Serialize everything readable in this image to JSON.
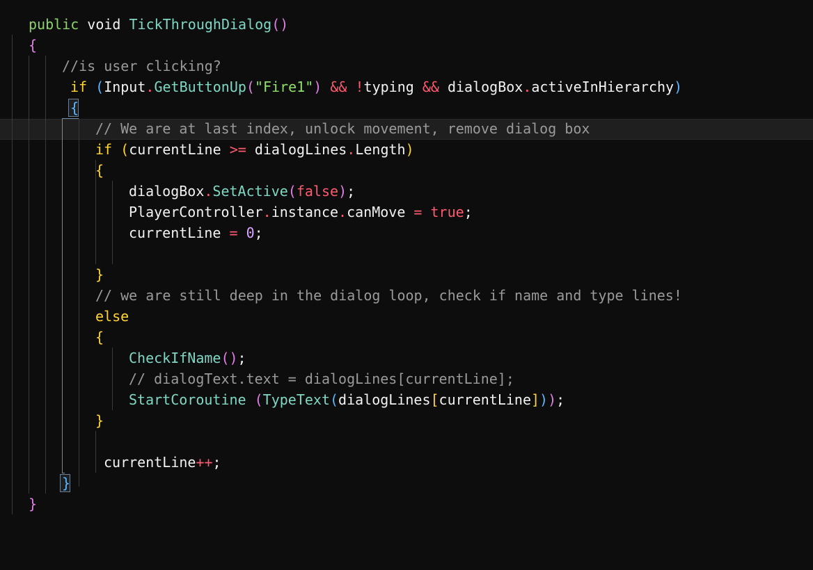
{
  "editor": {
    "lines": [
      [
        [
          "kw2",
          "public"
        ],
        [
          "txt",
          " "
        ],
        [
          "txt",
          "void"
        ],
        [
          "txt",
          " "
        ],
        [
          "fn",
          "TickThroughDialog"
        ],
        [
          "p2",
          "("
        ],
        [
          "p2",
          ")"
        ]
      ],
      [
        [
          "p2",
          "{"
        ]
      ],
      [
        [
          "cm",
          "//is user clicking?"
        ]
      ],
      [
        [
          "kw",
          "if"
        ],
        [
          "txt",
          " "
        ],
        [
          "p3",
          "("
        ],
        [
          "txt",
          "Input"
        ],
        [
          "op",
          "."
        ],
        [
          "fn",
          "GetButtonUp"
        ],
        [
          "p2",
          "("
        ],
        [
          "str",
          "\"Fire1\""
        ],
        [
          "p2",
          ")"
        ],
        [
          "txt",
          " "
        ],
        [
          "op",
          "&&"
        ],
        [
          "txt",
          " "
        ],
        [
          "op",
          "!"
        ],
        [
          "txt",
          "typing"
        ],
        [
          "txt",
          " "
        ],
        [
          "op",
          "&&"
        ],
        [
          "txt",
          " "
        ],
        [
          "txt",
          "dialogBox"
        ],
        [
          "op",
          "."
        ],
        [
          "txt",
          "activeInHierarchy"
        ],
        [
          "p3",
          ")"
        ]
      ],
      [
        [
          "p3",
          "{"
        ]
      ],
      [
        [
          "cm",
          "// We are at last index, unlock movement, remove dialog box"
        ]
      ],
      [
        [
          "kw",
          "if"
        ],
        [
          "txt",
          " "
        ],
        [
          "p1",
          "("
        ],
        [
          "txt",
          "currentLine"
        ],
        [
          "txt",
          " "
        ],
        [
          "op",
          ">="
        ],
        [
          "txt",
          " "
        ],
        [
          "txt",
          "dialogLines"
        ],
        [
          "op",
          "."
        ],
        [
          "txt",
          "Length"
        ],
        [
          "p1",
          ")"
        ]
      ],
      [
        [
          "p1",
          "{"
        ]
      ],
      [
        [
          "txt",
          "dialogBox"
        ],
        [
          "op",
          "."
        ],
        [
          "fn",
          "SetActive"
        ],
        [
          "p2",
          "("
        ],
        [
          "bool",
          "false"
        ],
        [
          "p2",
          ")"
        ],
        [
          "txt",
          ";"
        ]
      ],
      [
        [
          "txt",
          "PlayerController"
        ],
        [
          "op",
          "."
        ],
        [
          "txt",
          "instance"
        ],
        [
          "op",
          "."
        ],
        [
          "txt",
          "canMove"
        ],
        [
          "txt",
          " "
        ],
        [
          "op",
          "="
        ],
        [
          "txt",
          " "
        ],
        [
          "bool",
          "true"
        ],
        [
          "txt",
          ";"
        ]
      ],
      [
        [
          "txt",
          "currentLine"
        ],
        [
          "txt",
          " "
        ],
        [
          "op",
          "="
        ],
        [
          "txt",
          " "
        ],
        [
          "num",
          "0"
        ],
        [
          "txt",
          ";"
        ]
      ],
      [],
      [
        [
          "p1",
          "}"
        ]
      ],
      [
        [
          "cm",
          "// we are still deep in the dialog loop, check if name and type lines!"
        ]
      ],
      [
        [
          "kw",
          "else"
        ]
      ],
      [
        [
          "p1",
          "{"
        ]
      ],
      [
        [
          "fn",
          "CheckIfName"
        ],
        [
          "p2",
          "("
        ],
        [
          "p2",
          ")"
        ],
        [
          "txt",
          ";"
        ]
      ],
      [
        [
          "cm",
          "// dialogText.text = dialogLines[currentLine];"
        ]
      ],
      [
        [
          "fn",
          "StartCoroutine"
        ],
        [
          "txt",
          " "
        ],
        [
          "p2",
          "("
        ],
        [
          "fn",
          "TypeText"
        ],
        [
          "p3",
          "("
        ],
        [
          "txt",
          "dialogLines"
        ],
        [
          "p1",
          "["
        ],
        [
          "txt",
          "currentLine"
        ],
        [
          "p1",
          "]"
        ],
        [
          "p3",
          ")"
        ],
        [
          "p2",
          ")"
        ],
        [
          "txt",
          ";"
        ]
      ],
      [
        [
          "p1",
          "}"
        ]
      ],
      [],
      [
        [
          "txt",
          "currentLine"
        ],
        [
          "op",
          "++"
        ],
        [
          "txt",
          ";"
        ]
      ],
      [
        [
          "p3",
          "}"
        ]
      ],
      [
        [
          "p2",
          "}"
        ]
      ]
    ]
  }
}
